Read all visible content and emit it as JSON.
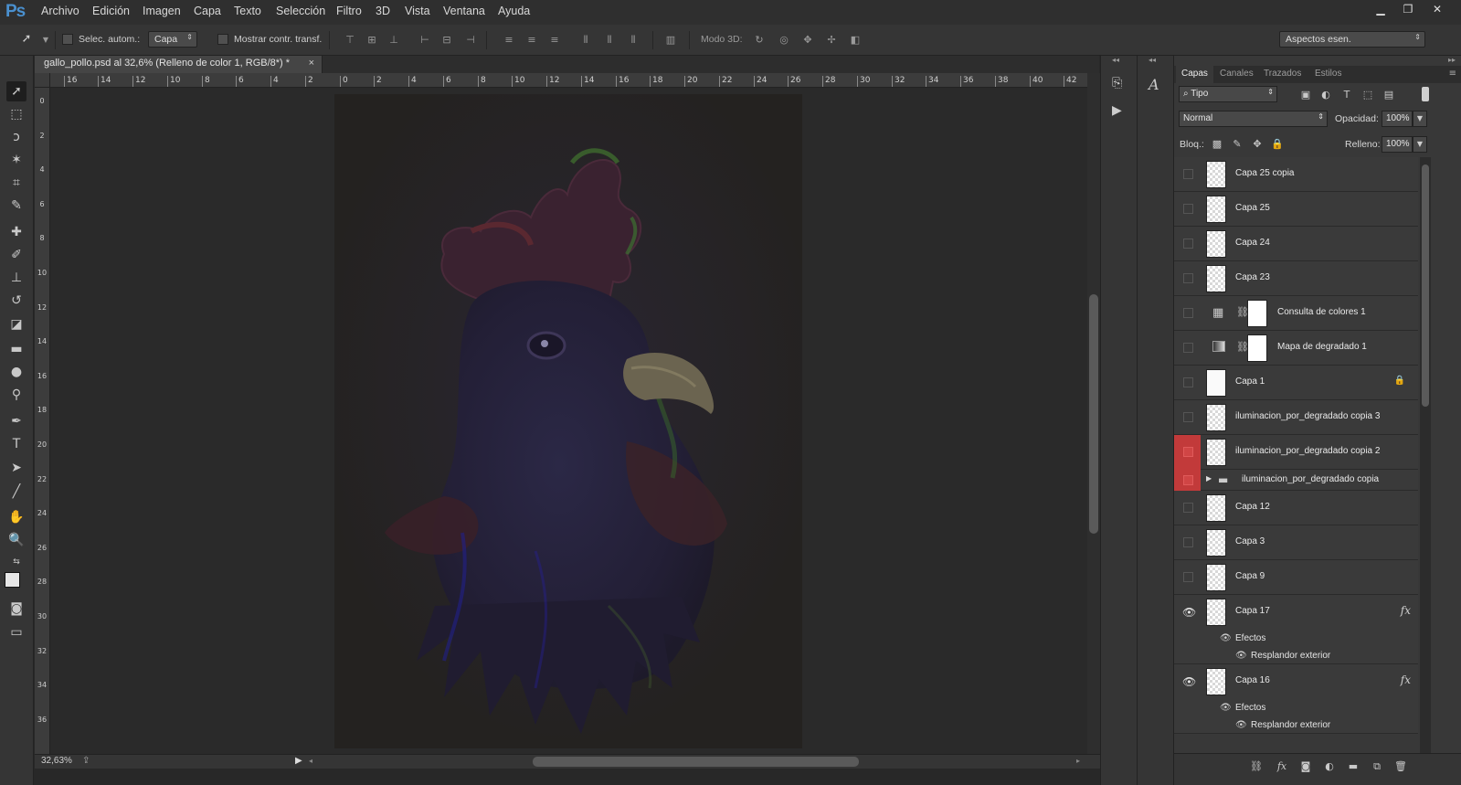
{
  "app": {
    "logo": "Ps"
  },
  "menu": [
    "Archivo",
    "Edición",
    "Imagen",
    "Capa",
    "Texto",
    "Selección",
    "Filtro",
    "3D",
    "Vista",
    "Ventana",
    "Ayuda"
  ],
  "options": {
    "auto_select_label": "Selec. autom.:",
    "auto_select_value": "Capa",
    "transform_label": "Mostrar contr. transf.",
    "mode3d_label": "Modo 3D:",
    "workspace": "Aspectos esen."
  },
  "document": {
    "tab_title": "gallo_pollo.psd al 32,6% (Relleno de color 1, RGB/8*) *",
    "zoom": "32,63%"
  },
  "rulers": {
    "h": [
      "16",
      "14",
      "12",
      "10",
      "8",
      "6",
      "4",
      "2",
      "0",
      "2",
      "4",
      "6",
      "8",
      "10",
      "12",
      "14",
      "16",
      "18",
      "20",
      "22",
      "24",
      "26",
      "28",
      "30",
      "32",
      "34",
      "36",
      "38",
      "40",
      "42"
    ],
    "v": [
      "0",
      "2",
      "4",
      "6",
      "8",
      "10",
      "12",
      "14",
      "16",
      "18",
      "20",
      "22",
      "24",
      "26",
      "28",
      "30",
      "32",
      "34",
      "36"
    ]
  },
  "layers_panel": {
    "tabs": [
      "Capas",
      "Canales",
      "Trazados",
      "Estilos"
    ],
    "filter": "Tipo",
    "blend_mode": "Normal",
    "opacity_label": "Opacidad:",
    "opacity": "100%",
    "lock_label": "Bloq.:",
    "fill_label": "Relleno:",
    "fill": "100%",
    "layers": [
      {
        "name": "Capa 25 copia"
      },
      {
        "name": "Capa 25"
      },
      {
        "name": "Capa 24"
      },
      {
        "name": "Capa 23"
      },
      {
        "name": "Consulta de colores 1"
      },
      {
        "name": "Mapa de degradado 1"
      },
      {
        "name": "Capa 1"
      },
      {
        "name": "iluminacion_por_degradado copia 3"
      },
      {
        "name": "iluminacion_por_degradado copia 2"
      },
      {
        "name": "iluminacion_por_degradado copia"
      },
      {
        "name": "Capa 12"
      },
      {
        "name": "Capa 3"
      },
      {
        "name": "Capa 9"
      },
      {
        "name": "Capa 17",
        "effects_label": "Efectos",
        "effect": "Resplandor exterior",
        "fx": "fx"
      },
      {
        "name": "Capa 16",
        "effects_label": "Efectos",
        "effect": "Resplandor exterior",
        "fx": "fx"
      }
    ]
  },
  "colors": {
    "accent_red": "#c23a3a",
    "ps_blue": "#4a90cf"
  }
}
